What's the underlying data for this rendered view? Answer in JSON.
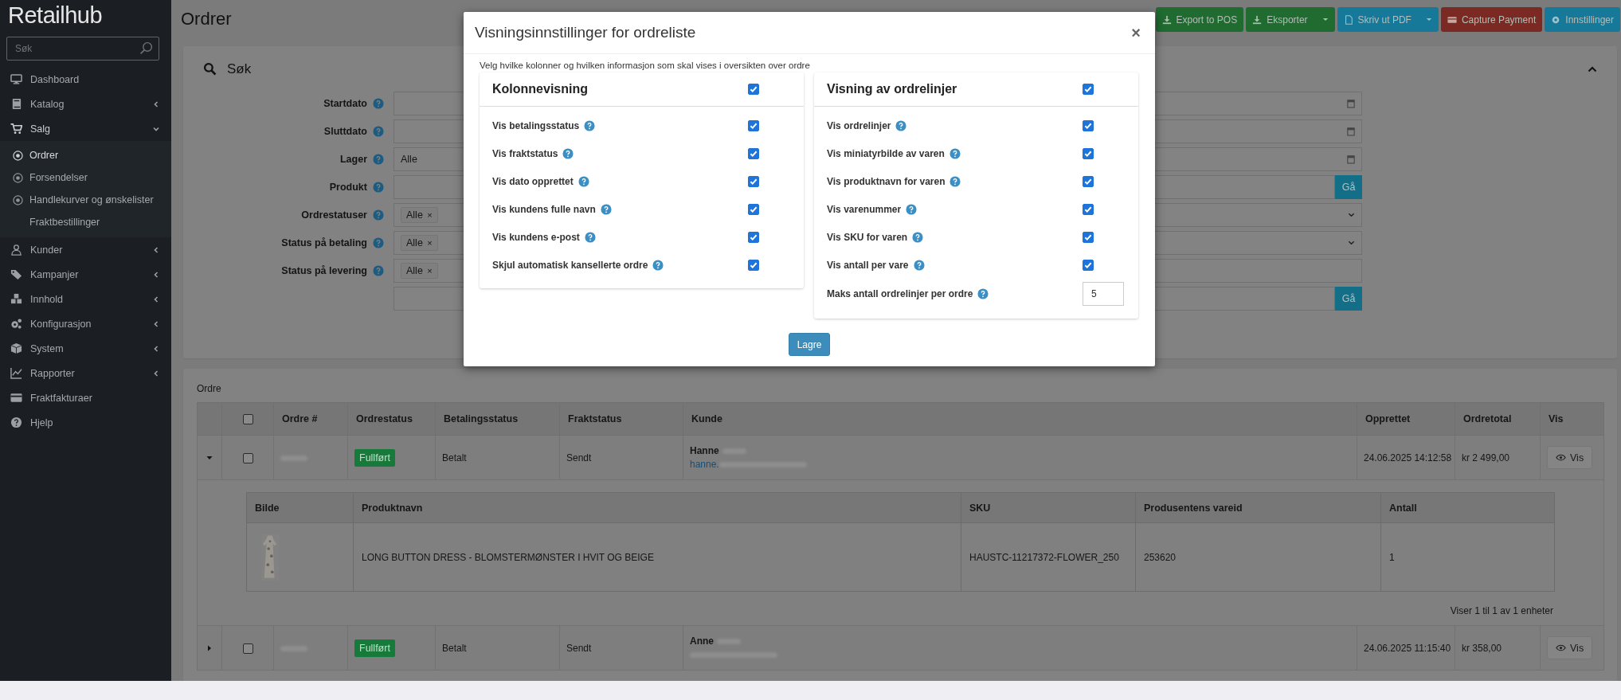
{
  "sidebar": {
    "logo": "Retailhub",
    "search": {
      "placeholder": "Søk"
    },
    "items": [
      {
        "label": "Dashboard"
      },
      {
        "label": "Katalog",
        "expanded": false
      },
      {
        "label": "Salg",
        "expanded": true,
        "children": [
          {
            "label": "Ordrer",
            "kind": "bullet",
            "selected": true
          },
          {
            "label": "Forsendelser",
            "kind": "bullet",
            "selected": false
          },
          {
            "label": "Handlekurver og ønskelister",
            "kind": "bullet",
            "selected": false
          },
          {
            "label": "Fraktbestillinger",
            "kind": "plain",
            "selected": false
          }
        ]
      },
      {
        "label": "Kunder",
        "expanded": false
      },
      {
        "label": "Kampanjer",
        "expanded": false
      },
      {
        "label": "Innhold",
        "expanded": false
      },
      {
        "label": "Konfigurasjon",
        "expanded": false
      },
      {
        "label": "System",
        "expanded": false
      },
      {
        "label": "Rapporter",
        "expanded": false
      },
      {
        "label": "Fraktfakturaer"
      },
      {
        "label": "Hjelp"
      }
    ]
  },
  "page": {
    "title": "Ordrer"
  },
  "toolbar": [
    {
      "label": "Export to POS",
      "color": "#1f6b30",
      "dropdown": false
    },
    {
      "label": "Eksporter",
      "color": "#1f6b30",
      "dropdown": true
    },
    {
      "label": "Skriv ut PDF",
      "color": "#17799a",
      "dropdown": true
    },
    {
      "label": "Capture Payment",
      "color": "#7a2a22",
      "dropdown": false
    },
    {
      "label": "Innstillinger",
      "color": "#17799a",
      "dropdown": false
    }
  ],
  "search_panel": {
    "title": "Søk",
    "expanded": true,
    "fields": [
      {
        "label": "Startdato",
        "kind": "picker"
      },
      {
        "label": "Sluttdato",
        "kind": "picker"
      },
      {
        "label": "Lager",
        "kind": "picker",
        "value": "Alle"
      },
      {
        "label": "Produkt",
        "kind": "go",
        "button": "Gå"
      },
      {
        "label": "Ordrestatuser",
        "kind": "tags",
        "chevron": true,
        "tags": [
          {
            "label": "Alle",
            "remove": "×"
          }
        ]
      },
      {
        "label": "Status på betaling",
        "kind": "tags",
        "chevron": true,
        "tags": [
          {
            "label": "Alle",
            "remove": "×"
          }
        ]
      },
      {
        "label": "Status på levering",
        "kind": "tags",
        "chevron": false,
        "tags": [
          {
            "label": "Alle",
            "remove": "×"
          }
        ]
      },
      {
        "kind": "go",
        "button": "Gå"
      }
    ]
  },
  "orders": {
    "title": "Ordre",
    "select_all": {
      "checked": false
    },
    "columns": [
      "Ordre #",
      "Ordrestatus",
      "Betalingsstatus",
      "Fraktstatus",
      "Kunde",
      "Opprettet",
      "Ordretotal",
      "Vis"
    ],
    "rows": [
      {
        "expanded": true,
        "checked": false,
        "status": "Fullført",
        "payment": "Betalt",
        "shipping": "Sendt",
        "customer": "Hanne",
        "email": "hanne.",
        "created": "24.06.2025 14:12:58",
        "total": "kr 2 499,00",
        "view": "Vis",
        "lines": {
          "columns": [
            "Bilde",
            "Produktnavn",
            "SKU",
            "Produsentens vareid",
            "Antall"
          ],
          "rows": [
            {
              "product": "LONG BUTTON DRESS - BLOMSTERMØNSTER I HVIT OG BEIGE",
              "sku": "HAUSTC-11217372-FLOWER_250",
              "vendor_id": "253620",
              "quantity": "1"
            }
          ],
          "footer": "Viser 1 til 1 av 1 enheter"
        }
      },
      {
        "expanded": false,
        "checked": false,
        "status": "Fullført",
        "payment": "Betalt",
        "shipping": "Sendt",
        "customer": "Anne",
        "created": "24.06.2025 11:15:40",
        "total": "kr 358,00",
        "view": "Vis"
      }
    ]
  },
  "modal": {
    "title": "Visningsinnstillinger for ordreliste",
    "close": "×",
    "description": "Velg hvilke kolonner og hvilken informasjon som skal vises i oversikten over ordre",
    "sections": [
      {
        "title": "Kolonnevisning",
        "checked": true,
        "rows": [
          {
            "kind": "checkbox",
            "label": "Vis betalingsstatus",
            "checked": true
          },
          {
            "kind": "checkbox",
            "label": "Vis fraktstatus",
            "checked": true
          },
          {
            "kind": "checkbox",
            "label": "Vis dato opprettet",
            "checked": true
          },
          {
            "kind": "checkbox",
            "label": "Vis kundens fulle navn",
            "checked": true
          },
          {
            "kind": "checkbox",
            "label": "Vis kundens e-post",
            "checked": true
          },
          {
            "kind": "checkbox",
            "label": "Skjul automatisk kansellerte ordre",
            "checked": true
          }
        ]
      },
      {
        "title": "Visning av ordrelinjer",
        "checked": true,
        "rows": [
          {
            "kind": "checkbox",
            "label": "Vis ordrelinjer",
            "checked": true
          },
          {
            "kind": "checkbox",
            "label": "Vis miniatyrbilde av varen",
            "checked": true
          },
          {
            "kind": "checkbox",
            "label": "Vis produktnavn for varen",
            "checked": true
          },
          {
            "kind": "checkbox",
            "label": "Vis varenummer",
            "checked": true
          },
          {
            "kind": "checkbox",
            "label": "Vis SKU for varen",
            "checked": true
          },
          {
            "kind": "checkbox",
            "label": "Vis antall per vare",
            "checked": true
          },
          {
            "kind": "number",
            "label": "Maks antall ordrelinjer per ordre",
            "value": "5"
          }
        ]
      }
    ],
    "save": "Lagre"
  }
}
